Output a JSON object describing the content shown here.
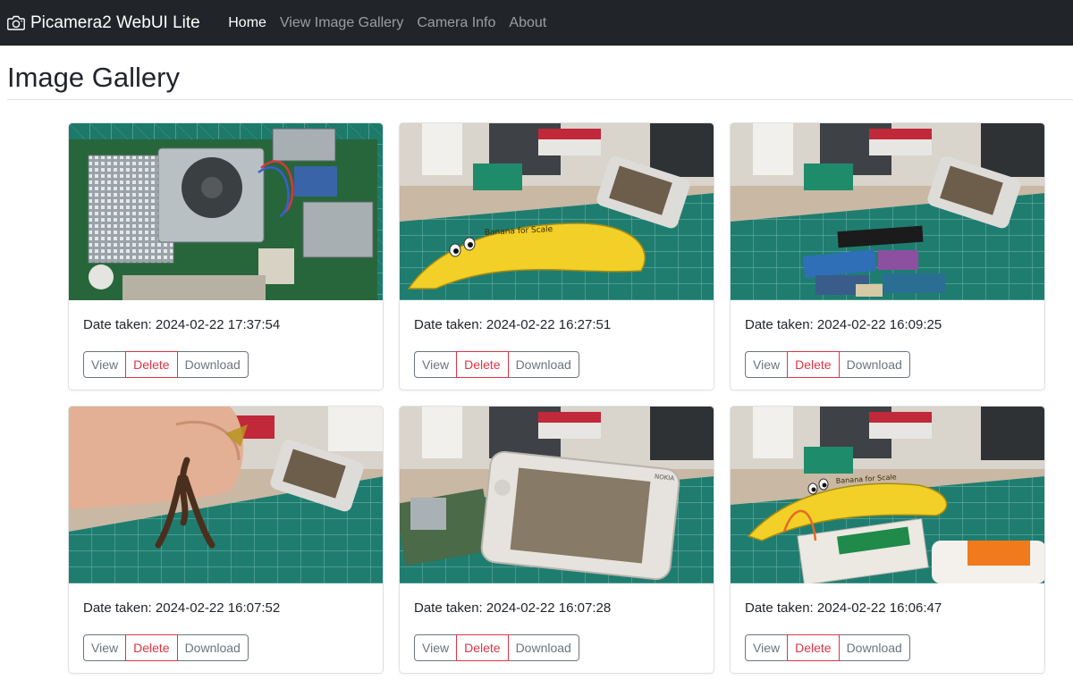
{
  "navbar": {
    "brand": "Picamera2 WebUI Lite",
    "brand_icon": "camera-icon",
    "links": [
      "Home",
      "View Image Gallery",
      "Camera Info",
      "About"
    ],
    "active": "Home"
  },
  "page": {
    "title": "Image Gallery"
  },
  "gallery": {
    "view_label": "View",
    "delete_label": "Delete",
    "download_label": "Download",
    "items": [
      {
        "date": "Date taken: 2024-02-22 17:37:54",
        "scene": "raspberry-pi-board"
      },
      {
        "date": "Date taken: 2024-02-22 16:27:51",
        "scene": "banana",
        "banana_text": "Banana for Scale"
      },
      {
        "date": "Date taken: 2024-02-22 16:09:25",
        "scene": "ssd-cards"
      },
      {
        "date": "Date taken: 2024-02-22 16:07:52",
        "scene": "hand-figure"
      },
      {
        "date": "Date taken: 2024-02-22 16:07:28",
        "scene": "nokia-device",
        "device_text": "NOKIA"
      },
      {
        "date": "Date taken: 2024-02-22 16:06:47",
        "scene": "banana-breadboard",
        "banana_text": "Banana for Scale"
      }
    ]
  },
  "colors": {
    "navbar_bg": "#212529",
    "danger": "#dc3545",
    "secondary": "#6c757d",
    "cutting_mat": "#1f7a6c"
  }
}
